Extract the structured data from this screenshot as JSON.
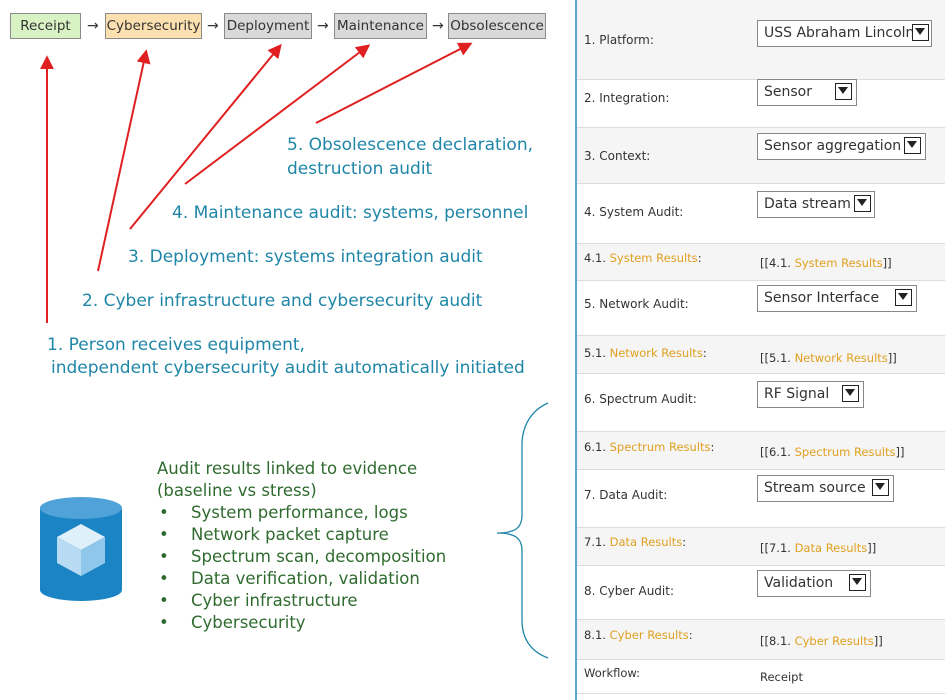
{
  "pipeline": {
    "stages": [
      "Receipt",
      "Cybersecurity",
      "Deployment",
      "Maintenance",
      "Obsolescence"
    ],
    "arrow_glyph": "→"
  },
  "annotations": {
    "step5_line1": "5. Obsolescence declaration,",
    "step5_line2": "destruction audit",
    "step4": "4. Maintenance audit: systems, personnel",
    "step3": "3. Deployment: systems integration audit",
    "step2": "2. Cyber infrastructure and cybersecurity audit",
    "step1_line1": "1. Person receives equipment,",
    "step1_line2": "independent cybersecurity audit automatically initiated"
  },
  "evidence": {
    "title_line1": "Audit results linked to evidence",
    "title_line2": "(baseline vs stress)",
    "bullet": "•",
    "items": [
      "System performance, logs",
      "Network packet capture",
      "Spectrum scan, decomposition",
      "Data verification, validation",
      "Cyber infrastructure",
      "Cybersecurity"
    ]
  },
  "form": {
    "platform": {
      "label": "1. Platform:",
      "value": "USS Abraham Lincoln"
    },
    "integration": {
      "label": "2. Integration:",
      "value": "Sensor"
    },
    "context": {
      "label": "3. Context:",
      "value": "Sensor aggregation"
    },
    "system_audit": {
      "label": "4. System Audit:",
      "value": "Data stream"
    },
    "system_results": {
      "num": "4.1.",
      "label": "System Results",
      "colon": ":",
      "value_prefix": "[[4.1.",
      "value_link": "System Results",
      "value_suffix": "]]"
    },
    "network_audit": {
      "label": "5. Network Audit:",
      "value": "Sensor Interface"
    },
    "network_results": {
      "num": "5.1.",
      "label": "Network Results",
      "colon": ":",
      "value_prefix": "[[5.1.",
      "value_link": "Network Results",
      "value_suffix": "]]"
    },
    "spectrum_audit": {
      "label": "6. Spectrum Audit:",
      "value": "RF Signal"
    },
    "spectrum_results": {
      "num": "6.1.",
      "label": "Spectrum Results",
      "colon": ":",
      "value_prefix": "[[6.1.",
      "value_link": "Spectrum Results",
      "value_suffix": "]]"
    },
    "data_audit": {
      "label": "7. Data Audit:",
      "value": "Stream source"
    },
    "data_results": {
      "num": "7.1.",
      "label": "Data Results",
      "colon": ":",
      "value_prefix": "[[7.1.",
      "value_link": "Data Results",
      "value_suffix": "]]"
    },
    "cyber_audit": {
      "label": "8. Cyber Audit:",
      "value": "Validation"
    },
    "cyber_results": {
      "num": "8.1.",
      "label": "Cyber Results",
      "colon": ":",
      "value_prefix": "[[8.1.",
      "value_link": "Cyber Results",
      "value_suffix": "]]"
    },
    "workflow": {
      "label": "Workflow:",
      "value": "Receipt"
    }
  },
  "colors": {
    "receipt_fill": "#d9f2c4",
    "cybersecurity_fill": "#fde0b0",
    "grey_stage_fill": "#d9d9d9",
    "annotation_text": "#1f86a8",
    "evidence_text": "#2f6b2f",
    "arrow": "#e02020",
    "link": "#e0a020",
    "database_icon": "#1b84c4",
    "panel_border": "#5aa7d6"
  }
}
